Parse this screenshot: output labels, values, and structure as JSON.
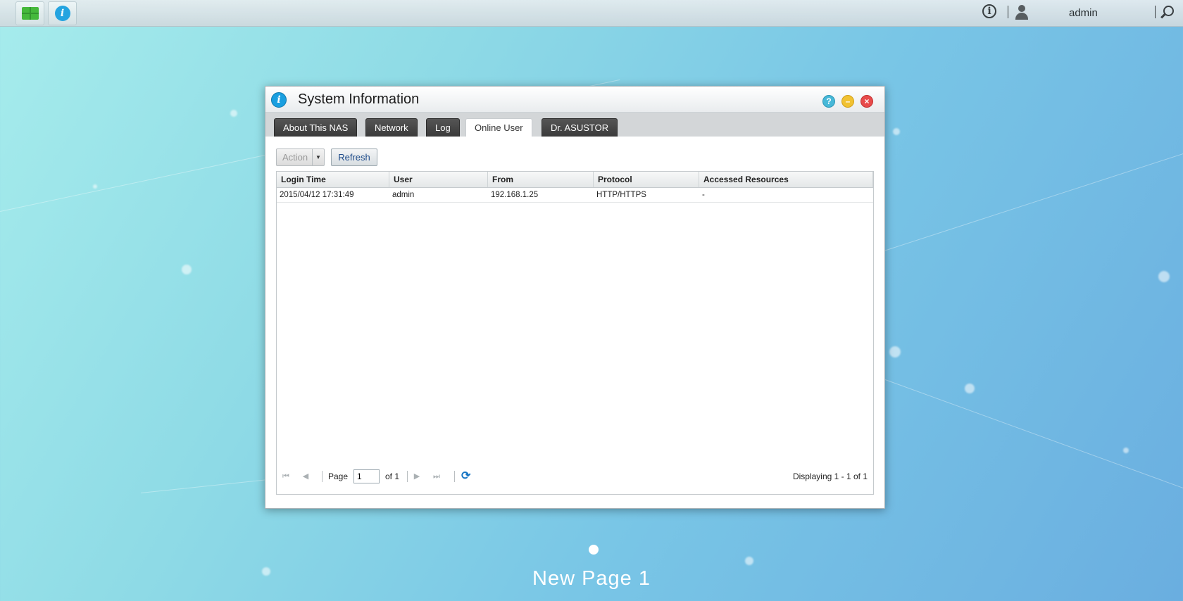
{
  "taskbar": {
    "user_name": "admin",
    "apps_button": "apps-icon",
    "sysinfo_button": "info-icon"
  },
  "window": {
    "title": "System Information",
    "controls": [
      "help",
      "minimize",
      "close"
    ],
    "tabs": [
      {
        "label": "About This NAS",
        "active": false
      },
      {
        "label": "Network",
        "active": false
      },
      {
        "label": "Log",
        "active": false
      },
      {
        "label": "Online User",
        "active": true
      },
      {
        "label": "Dr. ASUSTOR",
        "active": false
      }
    ],
    "toolbar": {
      "action_label": "Action",
      "refresh_label": "Refresh"
    },
    "grid": {
      "columns": [
        "Login Time",
        "User",
        "From",
        "Protocol",
        "Accessed Resources"
      ],
      "rows": [
        [
          "2015/04/12 17:31:49",
          "admin",
          "192.168.1.25",
          "HTTP/HTTPS",
          "-"
        ]
      ]
    },
    "pager": {
      "page_label": "Page",
      "page_value": "1",
      "of_label": "of 1",
      "display_text": "Displaying 1 - 1 of 1"
    }
  },
  "desktop": {
    "page_label": "New Page 1"
  },
  "colors": {
    "accent": "#1a9fe0",
    "tab_dark": "#3a3a3a",
    "close": "#e84b4b",
    "minimize": "#f1c232",
    "help": "#47b8d8"
  }
}
